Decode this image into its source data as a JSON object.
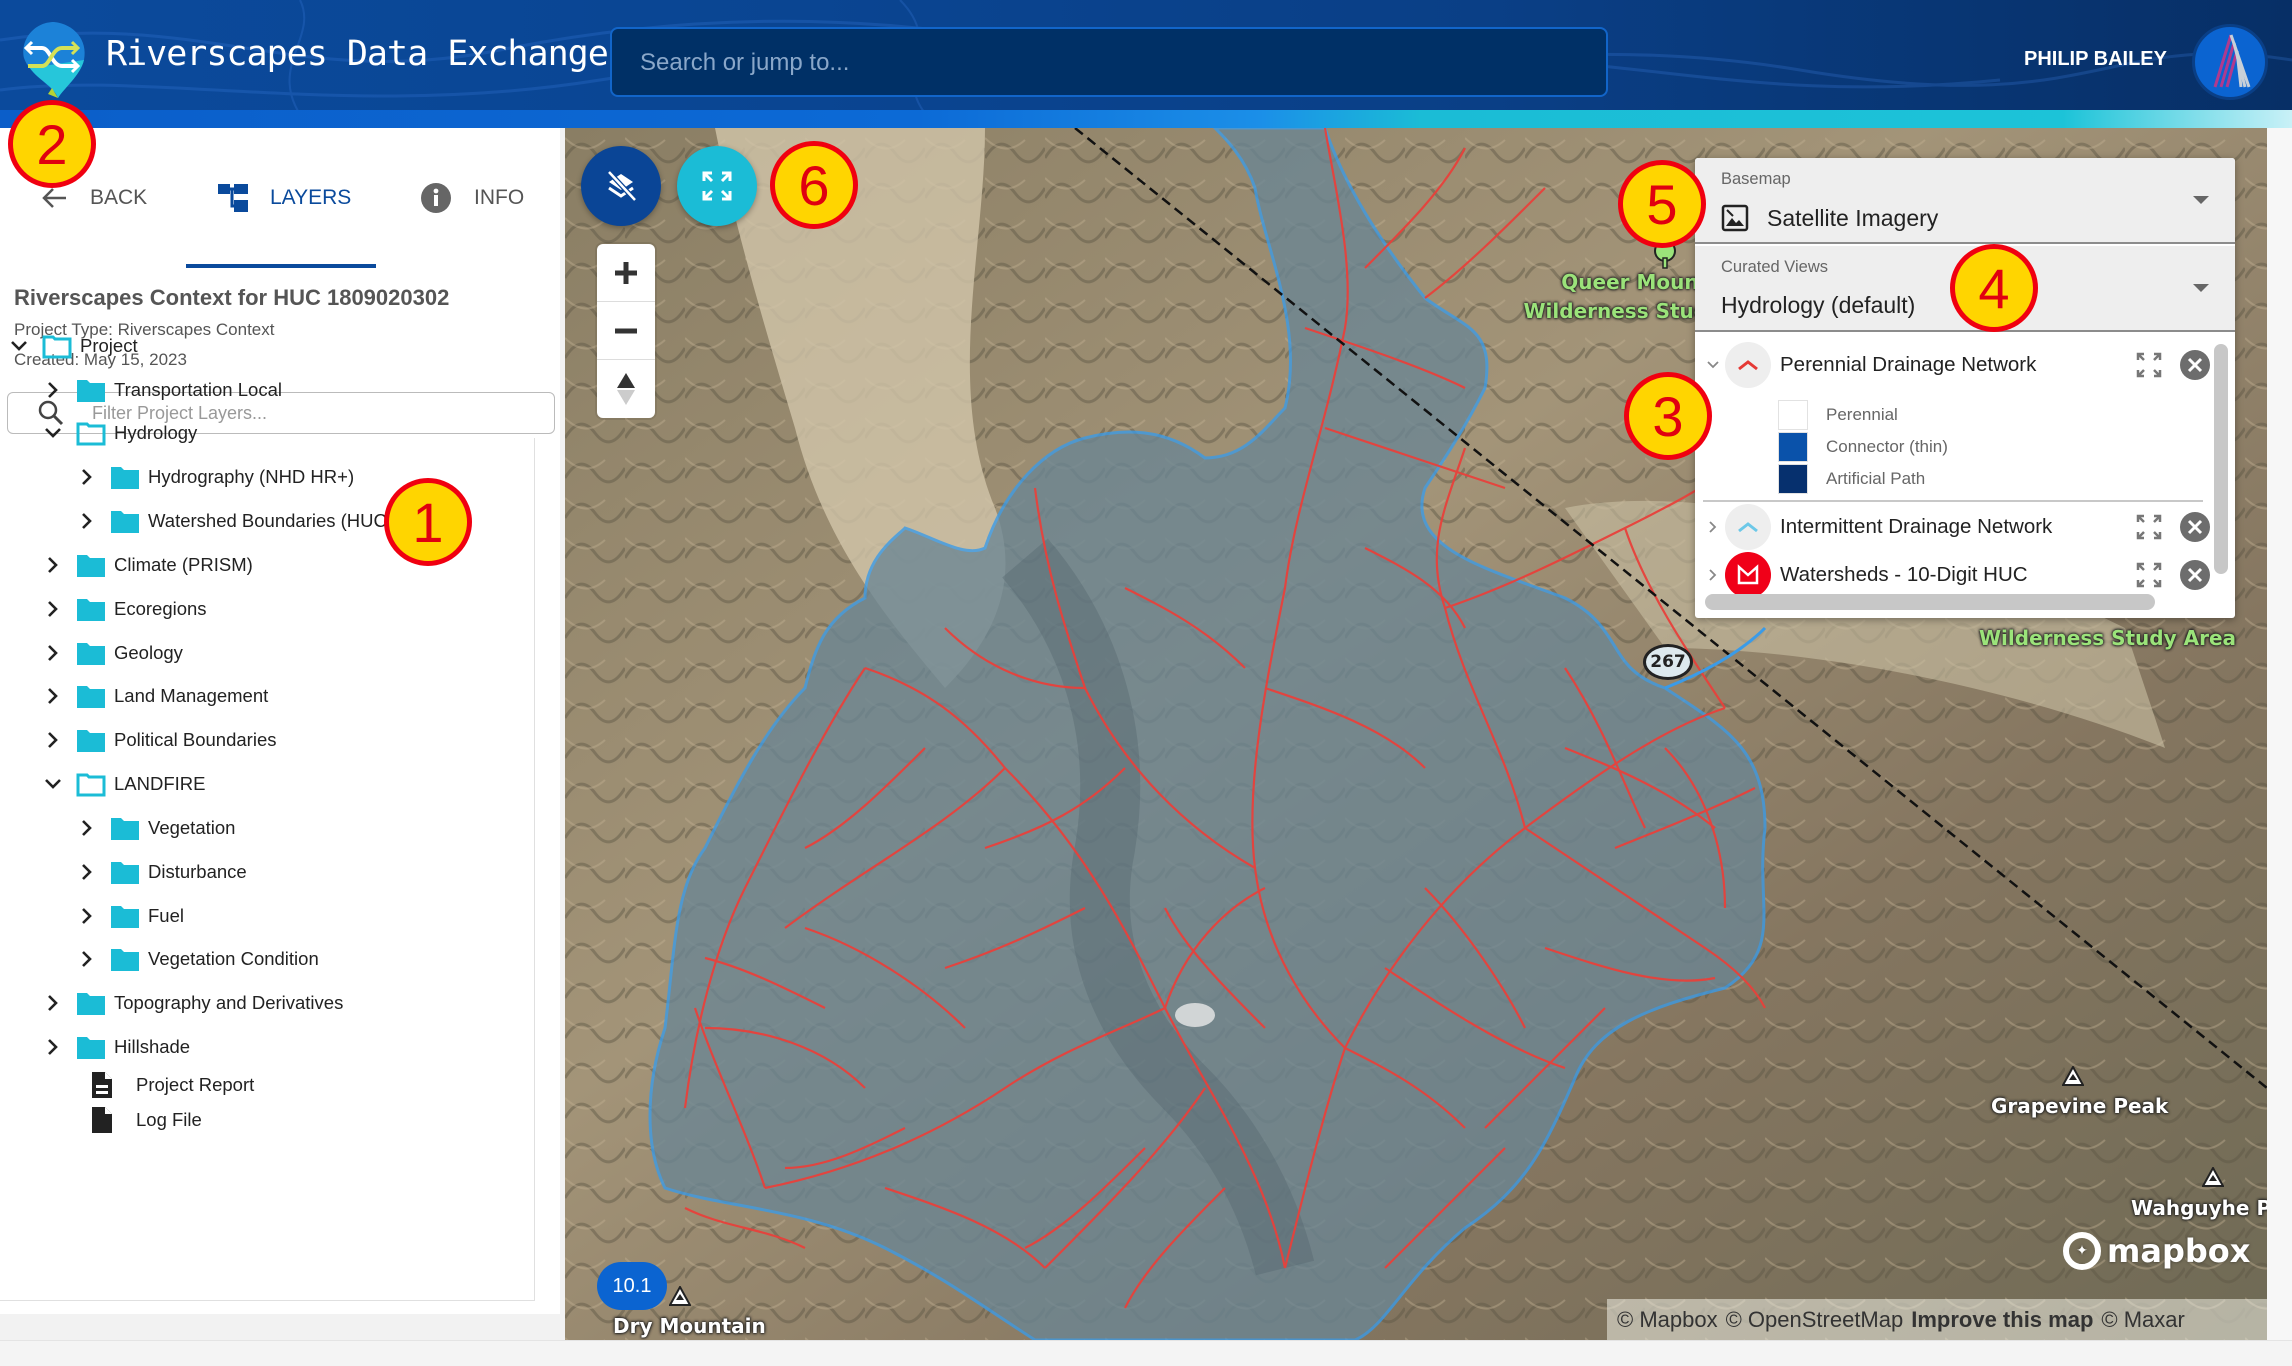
{
  "header": {
    "app_title": "Riverscapes Data Exchange",
    "search_placeholder": "Search or jump to...",
    "search_value": "",
    "user_name": "PHILIP BAILEY",
    "logo_icon": "shuffle-arrows-logo-icon",
    "avatar_icon": "user-avatar-stripes-icon"
  },
  "sidebar": {
    "tabs": [
      {
        "label": "BACK",
        "icon": "arrow-left-icon",
        "active": false
      },
      {
        "label": "LAYERS",
        "icon": "layers-tree-icon",
        "active": true
      },
      {
        "label": "INFO",
        "icon": "info-circle-icon",
        "active": false
      }
    ],
    "project": {
      "title": "Riverscapes Context for HUC 1809020302",
      "type_line": "Project Type: Riverscapes Context",
      "created_line": "Created: May 15, 2023"
    },
    "filter": {
      "placeholder": "Filter Project Layers...",
      "value": ""
    },
    "tree": [
      {
        "label": "Project",
        "level": 0,
        "kind": "folder",
        "expanded": true
      },
      {
        "label": "Transportation Local",
        "level": 1,
        "kind": "folder",
        "expanded": false
      },
      {
        "label": "Hydrology",
        "level": 1,
        "kind": "folder",
        "expanded": true
      },
      {
        "label": "Hydrography (NHD HR+)",
        "level": 2,
        "kind": "folder",
        "expanded": false
      },
      {
        "label": "Watershed Boundaries (HUCs)",
        "level": 2,
        "kind": "folder",
        "expanded": false
      },
      {
        "label": "Climate (PRISM)",
        "level": 1,
        "kind": "folder",
        "expanded": false
      },
      {
        "label": "Ecoregions",
        "level": 1,
        "kind": "folder",
        "expanded": false
      },
      {
        "label": "Geology",
        "level": 1,
        "kind": "folder",
        "expanded": false
      },
      {
        "label": "Land Management",
        "level": 1,
        "kind": "folder",
        "expanded": false
      },
      {
        "label": "Political Boundaries",
        "level": 1,
        "kind": "folder",
        "expanded": false
      },
      {
        "label": "LANDFIRE",
        "level": 1,
        "kind": "folder",
        "expanded": true
      },
      {
        "label": "Vegetation",
        "level": 2,
        "kind": "folder",
        "expanded": false
      },
      {
        "label": "Disturbance",
        "level": 2,
        "kind": "folder",
        "expanded": false
      },
      {
        "label": "Fuel",
        "level": 2,
        "kind": "folder",
        "expanded": false
      },
      {
        "label": "Vegetation Condition",
        "level": 2,
        "kind": "folder",
        "expanded": false
      },
      {
        "label": "Topography and Derivatives",
        "level": 1,
        "kind": "folder",
        "expanded": false
      },
      {
        "label": "Hillshade",
        "level": 1,
        "kind": "folder",
        "expanded": false
      },
      {
        "label": "Project Report",
        "level": 1,
        "kind": "report"
      },
      {
        "label": "Log File",
        "level": 1,
        "kind": "file"
      }
    ]
  },
  "map": {
    "controls": {
      "toggle_layers_icon": "layers-off-icon",
      "fit_bounds_icon": "fit-bounds-icon",
      "zoom_in_icon": "plus-icon",
      "zoom_out_icon": "minus-icon",
      "compass_icon": "compass-icon"
    },
    "zoom_level": "10.1",
    "labels": {
      "queer_mountain_1": "Queer Mountain",
      "queer_mountain_2": "Wilderness Study Area",
      "wilderness_area": "Wilderness Study Area",
      "grapevine_peak": "Grapevine Peak",
      "wahguyhe_peak": "Wahguyhe Pe",
      "dry_mountain": "Dry Mountain",
      "route_shield": "267"
    },
    "mapbox_logo": "mapbox",
    "attribution": {
      "mapbox": "© Mapbox",
      "osm": "© OpenStreetMap",
      "improve": "Improve this map",
      "maxar": "© Maxar"
    }
  },
  "layer_panel": {
    "basemap": {
      "label": "Basemap",
      "value": "Satellite Imagery",
      "icon": "image-icon"
    },
    "curated_views": {
      "label": "Curated Views",
      "value": "Hydrology (default)"
    },
    "layers": [
      {
        "name": "Perennial Drainage Network",
        "expanded": true,
        "icon": "line-layer-icon",
        "icon_color": "#e53935",
        "legend": [
          {
            "label": "Perennial",
            "color": "#ffffff"
          },
          {
            "label": "Connector (thin)",
            "color": "#0a52aa"
          },
          {
            "label": "Artificial Path",
            "color": "#06306e"
          }
        ]
      },
      {
        "name": "Intermittent Drainage Network",
        "expanded": false,
        "icon": "line-layer-icon",
        "icon_color": "#6cc8e8"
      },
      {
        "name": "Watersheds - 10-Digit HUC",
        "expanded": false,
        "icon": "polygon-layer-icon",
        "icon_color": "#f00018"
      }
    ]
  },
  "annotations": [
    "1",
    "2",
    "3",
    "4",
    "5",
    "6"
  ],
  "colors": {
    "brand_dark": "#0a4a9c",
    "accent_cyan": "#1bbcd6",
    "folder": "#1bbcd6",
    "stream_red": "#e8413b",
    "watershed_blue": "#3a9be8",
    "annotation_fill": "#ffd500",
    "annotation_ring": "#f00010"
  }
}
